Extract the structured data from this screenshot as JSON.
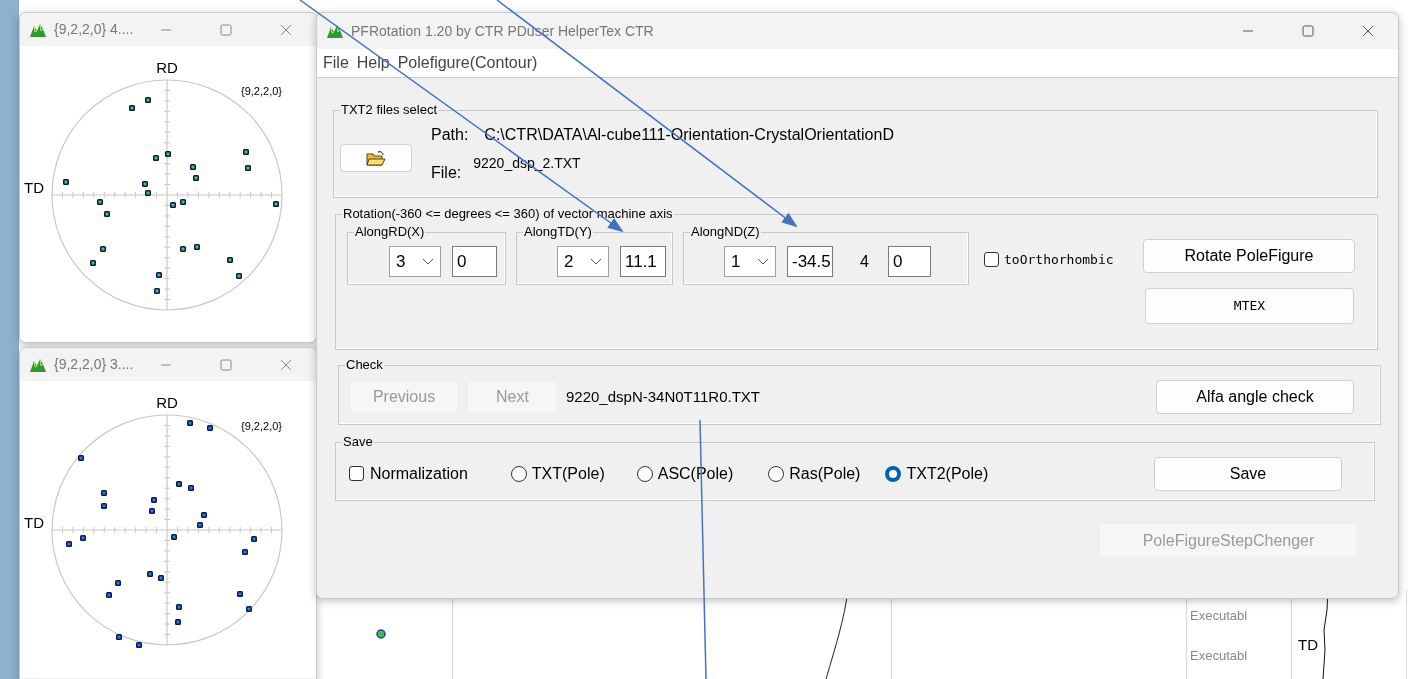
{
  "pole_windows": [
    {
      "title": "{9,2,2,0}  4....",
      "axis_top": "RD",
      "axis_left": "TD",
      "label": "{9,2,2,0}"
    },
    {
      "title": "{9,2,2,0}  3....",
      "axis_top": "RD",
      "axis_left": "TD",
      "label": "{9,2,2,0}"
    }
  ],
  "main_window": {
    "title": "PFRotation 1.20 by CTR PDuser HelperTex CTR",
    "menu": [
      "File",
      "Help",
      "Polefigure(Contour)"
    ],
    "file_select": {
      "legend": "TXT2 files select",
      "path_label": "Path:",
      "path": "C:\\CTR\\DATA\\Al-cube111-Orientation-CrystalOrientationD",
      "file_label": "File:",
      "file": "9220_dsp_2.TXT"
    },
    "rotation": {
      "legend": "Rotation(-360 <= degrees <= 360) of vector machine axis",
      "axes": [
        {
          "legend": "AlongRD(X)",
          "order": "3",
          "angle": "0"
        },
        {
          "legend": "AlongTD(Y)",
          "order": "2",
          "angle": "11.1"
        },
        {
          "legend": "AlongND(Z)",
          "order": "1",
          "angle": "-34.5",
          "extra_label": "4",
          "extra_value": "0"
        }
      ],
      "to_orthorhombic": {
        "label": "toOrthorhombic",
        "checked": false
      },
      "rotate_button": "Rotate PoleFigure",
      "mtex_button": "MTEX"
    },
    "check": {
      "legend": "Check",
      "previous": {
        "label": "Previous",
        "disabled": true
      },
      "next": {
        "label": "Next",
        "disabled": true
      },
      "filename": "9220_dspN-34N0T11R0.TXT",
      "alfa_button": "Alfa angle check"
    },
    "save": {
      "legend": "Save",
      "normalization": {
        "label": "Normalization",
        "checked": false
      },
      "formats": [
        {
          "label": "TXT(Pole)",
          "selected": false
        },
        {
          "label": "ASC(Pole)",
          "selected": false
        },
        {
          "label": "Ras(Pole)",
          "selected": false
        },
        {
          "label": "TXT2(Pole)",
          "selected": true
        }
      ],
      "save_button": "Save"
    },
    "step_changer": {
      "label": "PoleFigureStepChenger",
      "disabled": true
    }
  },
  "background": {
    "texts": [
      "Executabl",
      "Executabl"
    ],
    "axis_label": "TD"
  }
}
